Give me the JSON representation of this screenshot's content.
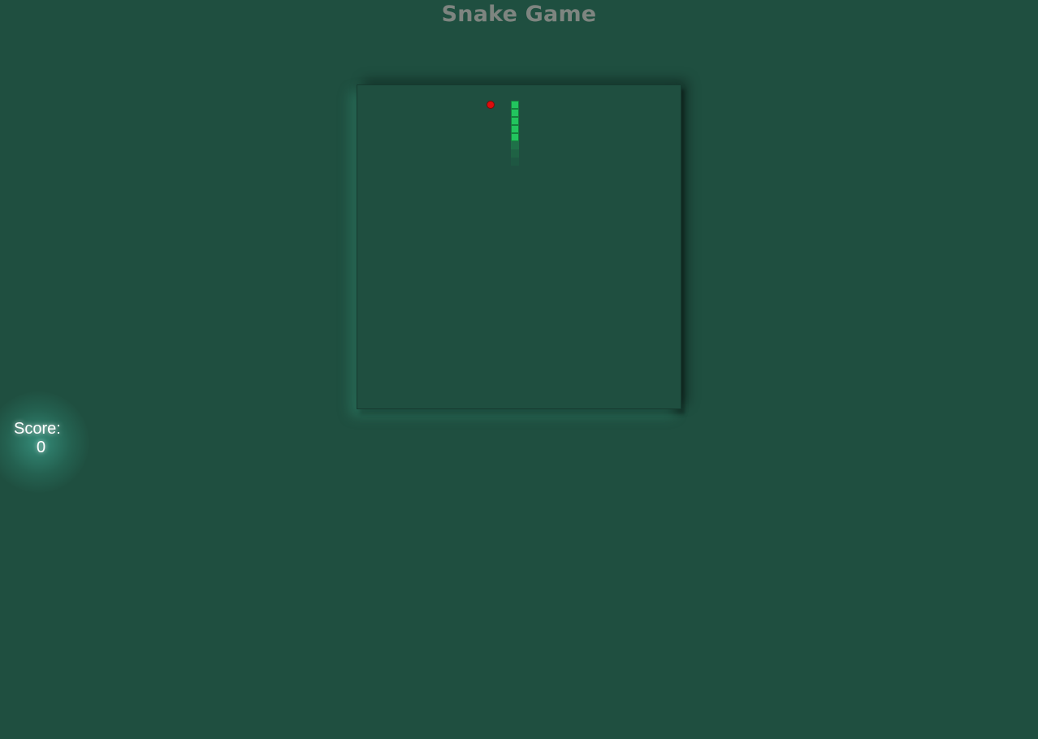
{
  "game": {
    "title": "Snake Game",
    "score_label": "Score:",
    "score_value": "0"
  },
  "colors": {
    "background": "#1f4f40",
    "snake": "#22c55e",
    "food": "#dc0d0d",
    "title": "#7e8580"
  },
  "snake": {
    "segments_visible": 5,
    "direction": "up"
  }
}
